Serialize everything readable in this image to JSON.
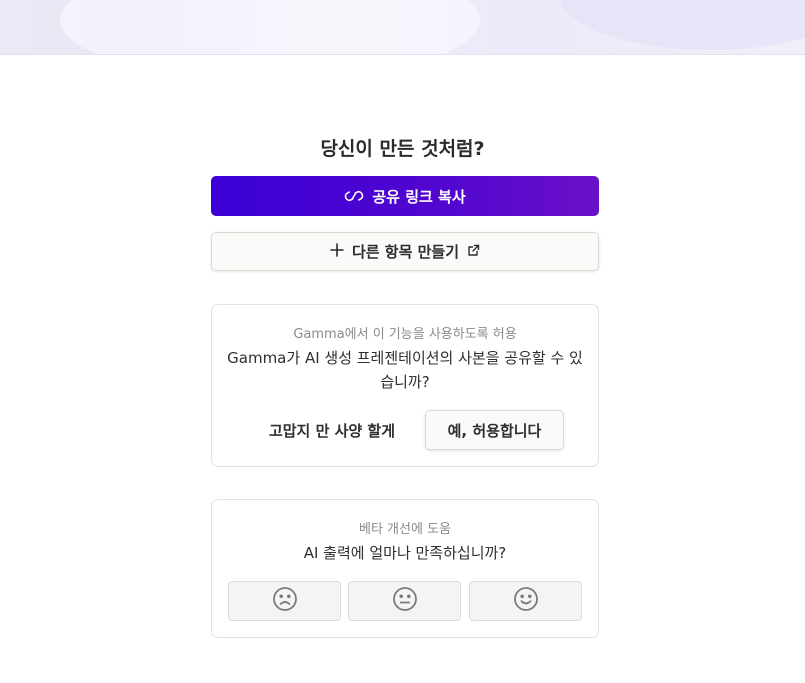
{
  "page_title": "당신이 만든 것처럼?",
  "share": {
    "copy_link_label": "공유 링크 복사",
    "copy_link_icon": "link-icon",
    "create_other_label": "다른 항목 만들기",
    "create_other_icon": "plus-icon",
    "external_icon": "external-link-icon"
  },
  "permission_card": {
    "kicker": "Gamma에서 이 기능을 사용하도록 허용",
    "question": "Gamma가 AI 생성 프레젠테이션의 사본을 공유할 수 있습니까?",
    "decline_label": "고맙지 만 사양 할게",
    "allow_label": "예, 허용합니다"
  },
  "beta_card": {
    "kicker": "베타 개선에 도움",
    "question": "AI 출력에 얼마나 만족하십니까?",
    "ratings": [
      {
        "icon": "sad-face-icon"
      },
      {
        "icon": "neutral-face-icon"
      },
      {
        "icon": "happy-face-icon"
      }
    ]
  },
  "colors": {
    "primary_gradient_start": "#3a00d6",
    "primary_gradient_end": "#6a10c9"
  }
}
